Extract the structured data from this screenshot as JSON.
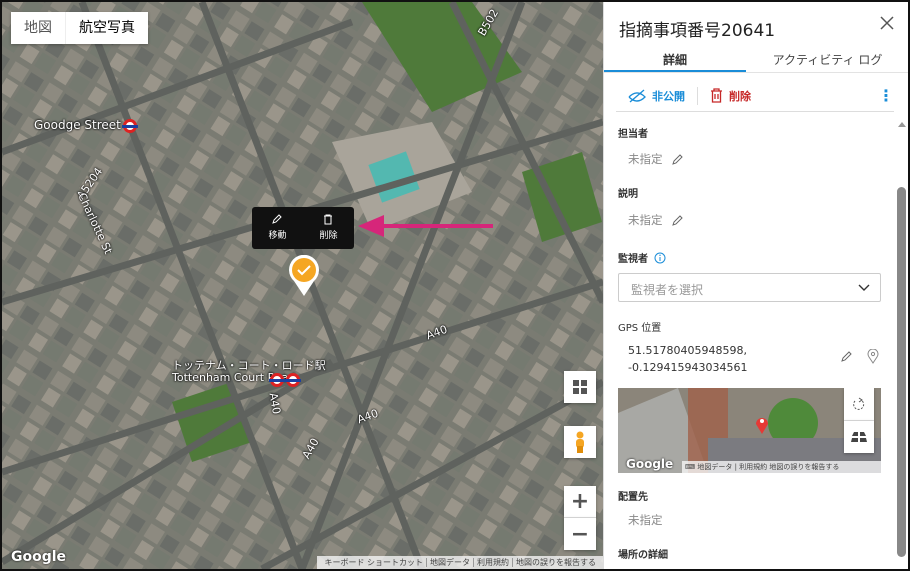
{
  "map": {
    "type_buttons": [
      "地図",
      "航空写真"
    ],
    "labels": {
      "goodge": "Goodge Street",
      "a5204": "A5204",
      "charlotte": "Charlotte St",
      "tottenham_jp": "トッテナム・コート・ロード駅",
      "tottenham_en": "Tottenham Court Road",
      "a40a": "A40",
      "a40b": "A40",
      "a40c": "A40",
      "a40d": "A40",
      "b502": "B502"
    },
    "popup": {
      "move": "移動",
      "delete": "削除"
    },
    "google": "Google",
    "attribution": [
      "キーボード ショートカット",
      "地図データ",
      "利用規約",
      "地図の誤りを報告する"
    ],
    "zoom_in": "+",
    "zoom_out": "−"
  },
  "panel": {
    "title": "指摘事項番号20641",
    "tabs": [
      "詳細",
      "アクティビティ ログ"
    ],
    "actions": {
      "private": "非公開",
      "delete": "削除"
    },
    "fields": {
      "assignee_label": "担当者",
      "assignee_value": "未指定",
      "description_label": "説明",
      "description_value": "未指定",
      "watchers_label": "監視者",
      "watchers_placeholder": "監視者を選択",
      "gps_label": "GPS 位置",
      "gps_lat": "51.51780405948598,",
      "gps_lng": "-0.129415943034561",
      "placement_label": "配置先",
      "placement_value": "未指定",
      "location_details_label": "場所の詳細"
    },
    "minimap": {
      "google": "Google",
      "attribution": [
        "地図データ",
        "利用規約",
        "地図の誤りを報告する"
      ]
    }
  },
  "colors": {
    "accent": "#1a8dd8",
    "danger": "#c62828",
    "arrow": "#d6267a",
    "pin": "#f5a623"
  }
}
